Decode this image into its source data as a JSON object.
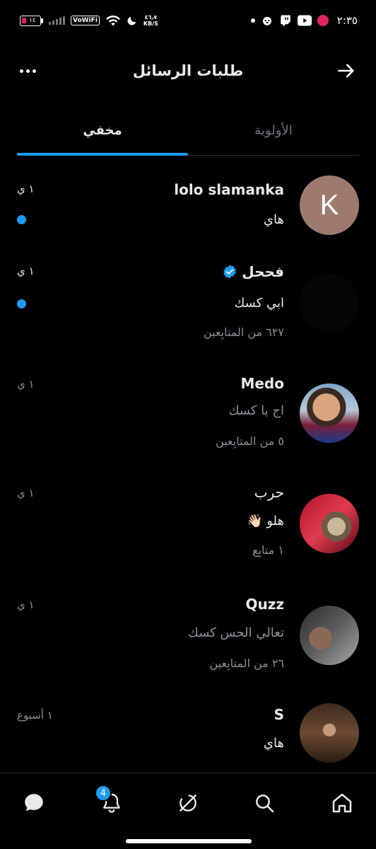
{
  "status_bar": {
    "battery": "١٤",
    "vowifi": "VoWiFi",
    "net_speed_value": "٤٦٫٧",
    "net_speed_unit": "KB/S",
    "clock": "٢:٣٥"
  },
  "header": {
    "title": "طلبات الرسائل"
  },
  "tabs": [
    {
      "label": "الأولوية"
    },
    {
      "label": "مخفي"
    }
  ],
  "conversations": [
    {
      "name": "lolo slamanka",
      "avatar_letter": "K",
      "message": "هاي",
      "time": "١ ي",
      "unread": true
    },
    {
      "name": "فححل",
      "verified": true,
      "message": "ابي كسك",
      "followers": "٦٢٧ من المتابِعين",
      "time": "١ ي",
      "unread": true
    },
    {
      "name": "Medo",
      "message": "اح يا كسك",
      "followers": "٥ من المتابِعين",
      "time": "١ ي"
    },
    {
      "name": "حرب",
      "message": "هلو 👋🏻",
      "followers": "١ متابِع",
      "time": "١ ي"
    },
    {
      "name": "Quzz",
      "message": "تعالي الحس كسك",
      "followers": "٢٦ من المتابِعين",
      "time": "١ ي"
    },
    {
      "name": "S",
      "message": "هاي",
      "time": "١ أسبوع"
    }
  ],
  "nav": {
    "notifications_badge": "4"
  },
  "colors": {
    "accent": "#1d9bf0",
    "background": "#000000"
  }
}
